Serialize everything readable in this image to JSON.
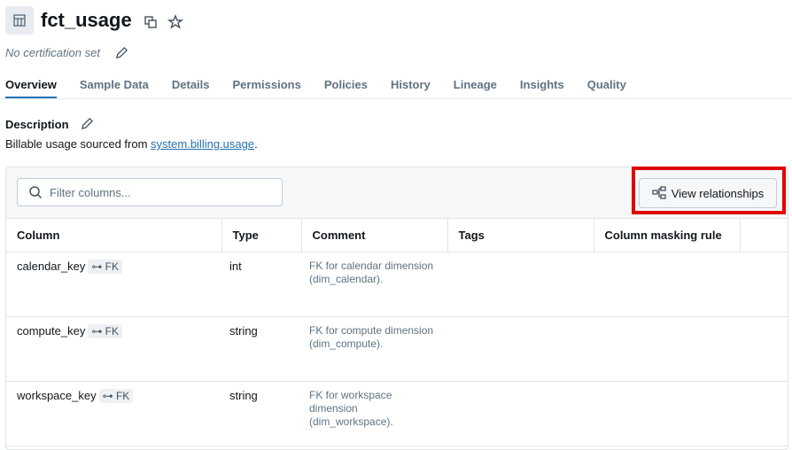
{
  "header": {
    "title": "fct_usage",
    "certification": "No certification set"
  },
  "tabs": [
    {
      "label": "Overview",
      "active": true
    },
    {
      "label": "Sample Data"
    },
    {
      "label": "Details"
    },
    {
      "label": "Permissions"
    },
    {
      "label": "Policies"
    },
    {
      "label": "History"
    },
    {
      "label": "Lineage"
    },
    {
      "label": "Insights"
    },
    {
      "label": "Quality"
    }
  ],
  "description": {
    "label": "Description",
    "text": "Billable usage sourced from ",
    "link": "system.billing.usage",
    "suffix": "."
  },
  "toolbar": {
    "filter_placeholder": "Filter columns...",
    "view_relationships": "View relationships"
  },
  "table": {
    "headers": [
      "Column",
      "Type",
      "Comment",
      "Tags",
      "Column masking rule"
    ],
    "rows": [
      {
        "column": "calendar_key",
        "badge": "FK",
        "type": "int",
        "comment": [
          "FK for calendar dimension",
          "(dim_calendar)."
        ]
      },
      {
        "column": "compute_key",
        "badge": "FK",
        "type": "string",
        "comment": [
          "FK for compute dimension",
          "(dim_compute)."
        ]
      },
      {
        "column": "workspace_key",
        "badge": "FK",
        "type": "string",
        "comment": [
          "FK for workspace",
          "dimension",
          "(dim_workspace)."
        ]
      }
    ]
  },
  "colors": {
    "accent": "#2272b4",
    "highlight": "#e00000"
  }
}
